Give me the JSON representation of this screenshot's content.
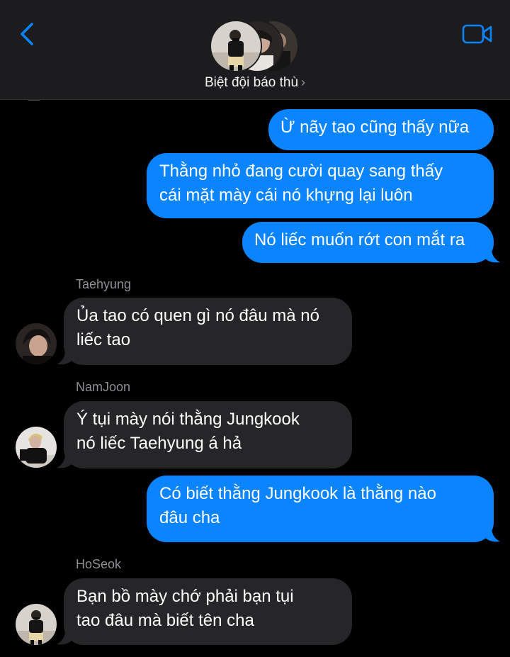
{
  "header": {
    "group_name": "Biệt đội báo thù",
    "back_icon": "chevron-left-icon",
    "video_icon": "video-camera-icon",
    "accent_color": "#0a84ff"
  },
  "messages": [
    {
      "direction": "outgoing",
      "text": "Ừ nãy tao cũng thấy nữa"
    },
    {
      "direction": "outgoing",
      "lines": [
        "Thằng nhỏ đang cười quay sang thấy",
        "cái mặt mày cái nó khựng lại luôn"
      ]
    },
    {
      "direction": "outgoing",
      "text": "Nó liếc muốn rớt con mắt ra"
    },
    {
      "direction": "incoming",
      "sender": "Taehyung",
      "lines": [
        "Ủa tao có quen gì nó đâu mà nó",
        "liếc tao"
      ]
    },
    {
      "direction": "incoming",
      "sender": "NamJoon",
      "lines": [
        "Ý tụi mày nói thằng Jungkook",
        "nó liếc Taehyung á hả"
      ]
    },
    {
      "direction": "outgoing",
      "lines": [
        "Có biết thằng Jungkook là thằng nào",
        "đâu cha"
      ]
    },
    {
      "direction": "incoming",
      "sender": "HoSeok",
      "lines": [
        "Bạn bồ mày chớ phải bạn tụi",
        "tao đâu mà biết tên cha"
      ]
    }
  ],
  "colors": {
    "outgoing_bubble": "#0a84ff",
    "incoming_bubble": "#262628",
    "background": "#000000",
    "header": "#1c1c1e",
    "sender_label": "#8e8e93"
  }
}
